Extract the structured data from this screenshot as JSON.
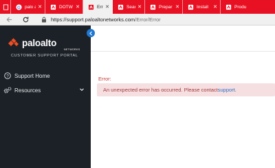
{
  "browser": {
    "tabs": [
      {
        "label": "",
        "icon": "page-icon"
      },
      {
        "label": "palo al",
        "icon": "google-icon"
      },
      {
        "label": "DOTW",
        "icon": "paloalto-icon"
      },
      {
        "label": "Error -",
        "icon": "paloalto-icon",
        "active": true
      },
      {
        "label": "Search",
        "icon": "paloalto-icon"
      },
      {
        "label": "Prepar",
        "icon": "paloalto-icon"
      },
      {
        "label": "Install",
        "icon": "paloalto-icon"
      },
      {
        "label": "Produ",
        "icon": "paloalto-icon"
      }
    ],
    "url_host": "https://support.paloaltonetworks.com",
    "url_path": "/Error/Error"
  },
  "sidebar": {
    "logo_text": "paloalto",
    "logo_sub": "NETWORKS",
    "portal_title": "CUSTOMER SUPPORT PORTAL",
    "items": [
      {
        "label": "Support Home",
        "icon": "question-circle-icon"
      },
      {
        "label": "Resources",
        "icon": "gears-icon"
      }
    ]
  },
  "main": {
    "error_title": "Error:",
    "error_message": "An unexpected error has occurred. Please contact ",
    "error_link": "support",
    "error_suffix": "."
  },
  "colors": {
    "tabstrip": "#e81123",
    "sidebar": "#1c2127",
    "accent": "#1f78d1",
    "error_text": "#c23934",
    "alert_bg": "#f5dfe1"
  }
}
